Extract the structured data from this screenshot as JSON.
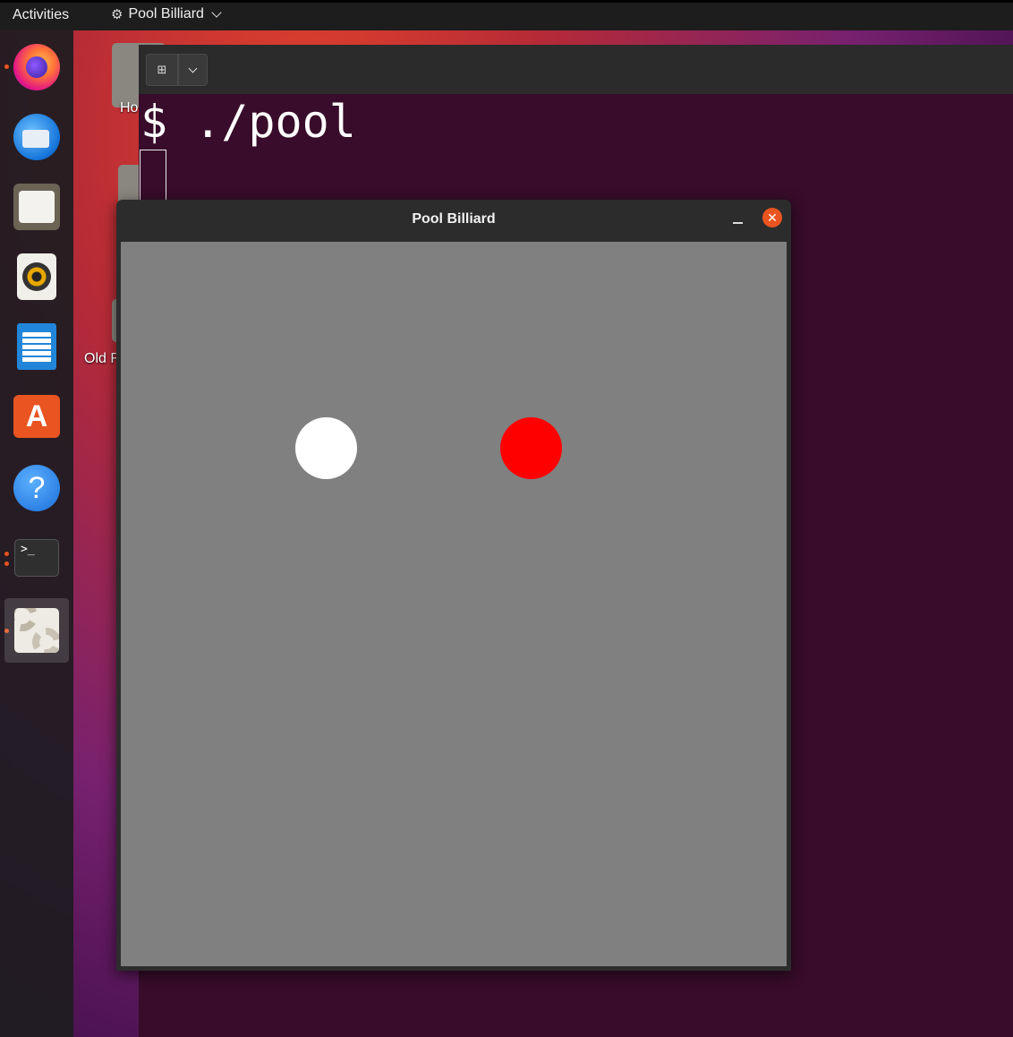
{
  "topbar": {
    "activities_label": "Activities",
    "app_menu_label": "Pool Billiard",
    "app_menu_icon": "gear-sparkle-icon"
  },
  "dock": {
    "items": [
      {
        "name": "Firefox",
        "icon": "firefox-icon",
        "running": true
      },
      {
        "name": "Thunderbird",
        "icon": "thunderbird-icon",
        "running": false
      },
      {
        "name": "Files",
        "icon": "files-icon",
        "running": false
      },
      {
        "name": "Rhythmbox",
        "icon": "rhythmbox-icon",
        "running": false
      },
      {
        "name": "LibreOffice Writer",
        "icon": "writer-icon",
        "running": false
      },
      {
        "name": "Ubuntu Software",
        "icon": "software-icon",
        "running": false
      },
      {
        "name": "Help",
        "icon": "help-icon",
        "running": false
      },
      {
        "name": "Terminal",
        "icon": "terminal-icon",
        "running": true
      },
      {
        "name": "Pool Billiard",
        "icon": "pool-app-icon",
        "running": true,
        "active": true
      }
    ],
    "software_glyph": "A",
    "help_glyph": "?",
    "terminal_glyph": ">_"
  },
  "desktop": {
    "icons": [
      {
        "label": "Ho"
      },
      {
        "label": "Old F"
      }
    ]
  },
  "terminal": {
    "command_line": "$ ./pool"
  },
  "pool_window": {
    "title": "Pool Billiard",
    "close_glyph": "✕",
    "canvas_color": "#808080",
    "balls": [
      {
        "name": "cue-ball",
        "color": "#ffffff"
      },
      {
        "name": "red-ball",
        "color": "#ff0000"
      }
    ]
  },
  "colors": {
    "accent": "#e95420",
    "terminal_bg": "#380c2a",
    "topbar_bg": "#1d1d1d"
  }
}
